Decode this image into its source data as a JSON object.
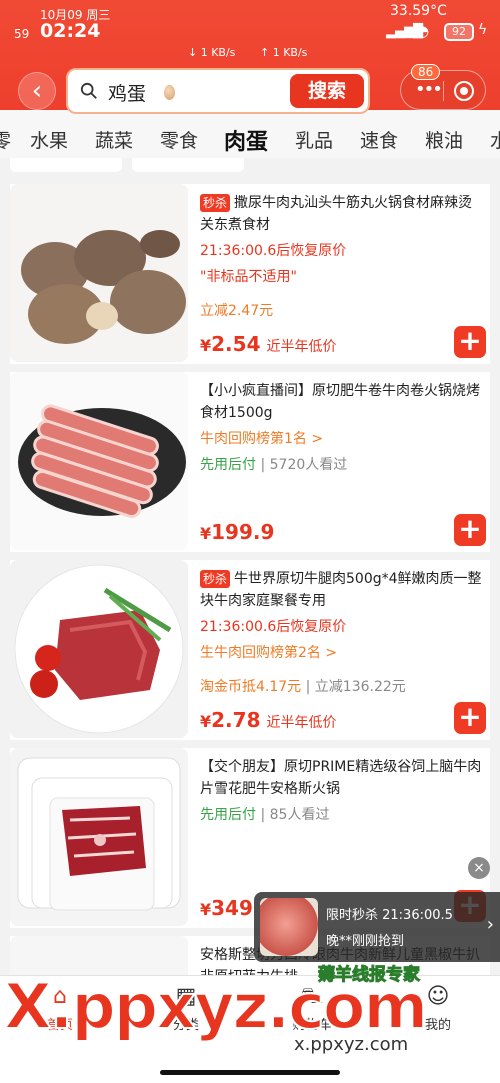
{
  "status": {
    "date": "10月09 周三",
    "num": "59",
    "time": "02:24",
    "net_down": "↓ 1 KB/s",
    "net_up": "↑ 1 KB/s",
    "temp": "33.59°C",
    "battery": "92"
  },
  "search": {
    "query": "鸡蛋",
    "button": "搜索"
  },
  "capsule": {
    "badge": "86"
  },
  "categories": [
    "零",
    "水果",
    "蔬菜",
    "零食",
    "肉蛋",
    "乳品",
    "速食",
    "粮油",
    "水"
  ],
  "active_category": "肉蛋",
  "products": [
    {
      "tag": "秒杀",
      "title": "撒尿牛肉丸汕头牛筋丸火锅食材麻辣烫关东煮食材",
      "countdown": "21:36:00.6后恢复原价",
      "note": "\"非标品不适用\"",
      "discount": "立减2.47元",
      "price_sym": "¥",
      "price": "2.54",
      "price_note": "近半年低价"
    },
    {
      "title": "【小小疯直播间】原切肥牛卷牛肉卷火锅烧烤食材1500g",
      "rank": "牛肉回购榜第1名 >",
      "pay": "先用后付",
      "views": "5720人看过",
      "price_sym": "¥",
      "price": "199.9"
    },
    {
      "tag": "秒杀",
      "title": "牛世界原切牛腿肉500g*4鲜嫩肉质一整块牛肉家庭聚餐专用",
      "countdown": "21:36:00.6后恢复原价",
      "rank": "生牛肉回购榜第2名 >",
      "coin": "淘金币抵4.17元",
      "discount": "立减136.22元",
      "price_sym": "¥",
      "price": "2.78",
      "price_note": "近半年低价"
    },
    {
      "title": "【交个朋友】原切PRIME精选级谷饲上脑牛肉片雪花肥牛安格斯火锅",
      "pay": "先用后付",
      "views": "85人看过",
      "price_sym": "¥",
      "price": "349"
    },
    {
      "title": "安格斯整切力西冷眼肉牛肉新鲜儿童黑椒牛扒非原切菲力牛排"
    }
  ],
  "flash": {
    "label": "限时秒杀 21:36:00.5",
    "sub": "晚**刚刚抢到"
  },
  "nav": [
    "首页",
    "分类",
    "购物车",
    "我的"
  ],
  "watermark": {
    "big": "X.ppxyz.com",
    "small": "x.ppxyz.com",
    "badge": "薅羊线报专家"
  },
  "colors": {
    "brand": "#ef3a24",
    "green": "#3aa34a"
  }
}
